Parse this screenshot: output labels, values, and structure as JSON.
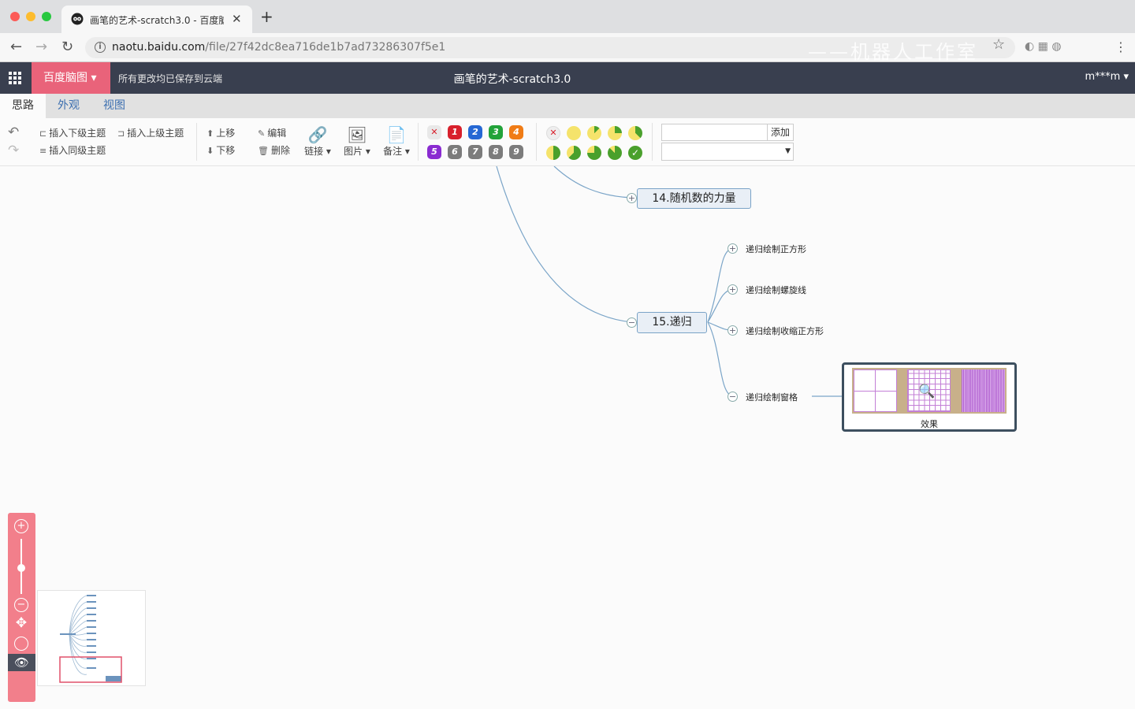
{
  "browser": {
    "tab_title": "画笔的艺术-scratch3.0 - 百度脑图",
    "url_host": "naotu.baidu.com",
    "url_path": "/file/27f42dc8ea716de1b7ad73286307f5e1",
    "watermark": "——机器人工作室"
  },
  "header": {
    "brand": "百度脑图",
    "save_status": "所有更改均已保存到云端",
    "doc_title": "画笔的艺术-scratch3.0",
    "user": "m***m"
  },
  "tabs": [
    {
      "label": "思路",
      "active": true
    },
    {
      "label": "外观",
      "active": false
    },
    {
      "label": "视图",
      "active": false
    }
  ],
  "toolbar": {
    "insert_child": "插入下级主题",
    "insert_parent": "插入上级主题",
    "insert_sibling": "插入同级主题",
    "move_up": "上移",
    "move_down": "下移",
    "edit": "编辑",
    "delete": "删除",
    "link": "链接",
    "image": "图片",
    "note": "备注",
    "priorities": [
      {
        "label": "1",
        "color": "#d8202c"
      },
      {
        "label": "2",
        "color": "#2668d4"
      },
      {
        "label": "3",
        "color": "#22a33a"
      },
      {
        "label": "4",
        "color": "#f07c16"
      },
      {
        "label": "5",
        "color": "#8a2bd1"
      },
      {
        "label": "6",
        "color": "#7c7c7c"
      },
      {
        "label": "7",
        "color": "#7c7c7c"
      },
      {
        "label": "8",
        "color": "#7c7c7c"
      },
      {
        "label": "9",
        "color": "#7c7c7c"
      }
    ],
    "tag_add": "添加"
  },
  "mindmap": {
    "topic14": "14.随机数的力量",
    "topic15": "15.递归",
    "children": [
      "递归绘制正方形",
      "递归绘制螺旋线",
      "递归绘制收缩正方形",
      "递归绘制窗格"
    ],
    "image_caption": "效果"
  },
  "colors": {
    "header_bg": "#393f4f",
    "brand_bg": "#e9637a",
    "zoom_panel": "#f27f8b",
    "link_line": "#7ba5c8"
  }
}
